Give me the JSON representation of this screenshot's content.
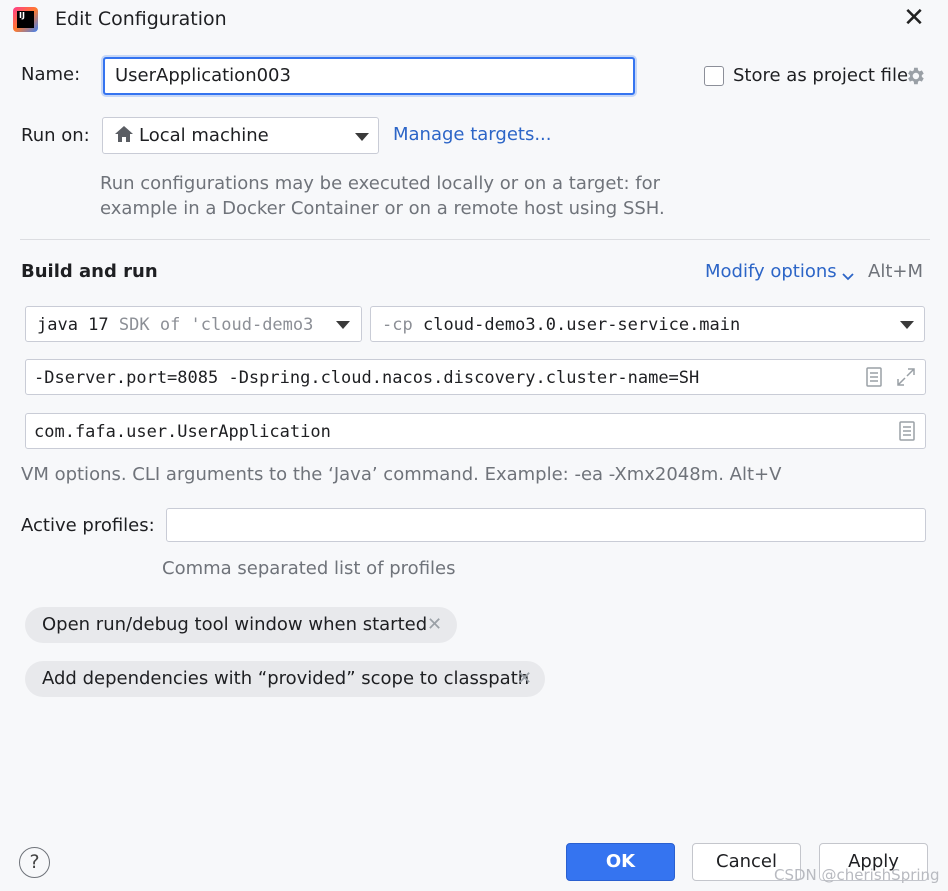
{
  "window": {
    "title": "Edit Configuration",
    "icon_text": "IJ"
  },
  "name_row": {
    "label": "Name:",
    "value": "UserApplication003",
    "store_label": "Store as project file",
    "store_checked": false
  },
  "run_on": {
    "label": "Run on:",
    "value": "Local machine",
    "manage_link": "Manage targets...",
    "hint_line1": "Run configurations may be executed locally or on a target: for",
    "hint_line2": "example in a Docker Container or on a remote host using SSH."
  },
  "build": {
    "heading": "Build and run",
    "modify_link": "Modify options",
    "modify_shortcut": "Alt+M",
    "jdk_version": "java 17",
    "jdk_suffix": "SDK of 'cloud-demo3",
    "cp_prefix": "-cp",
    "cp_value": "cloud-demo3.0.user-service.main",
    "vm_options": "-Dserver.port=8085 -Dspring.cloud.nacos.discovery.cluster-name=SH",
    "main_class": "com.fafa.user.UserApplication",
    "vm_hint": "VM options. CLI arguments to the ‘Java’ command. Example: -ea -Xmx2048m. Alt+V"
  },
  "profiles": {
    "label": "Active profiles:",
    "value": "",
    "hint": "Comma separated list of profiles"
  },
  "chips": [
    {
      "label": "Open run/debug tool window when started"
    },
    {
      "label": "Add dependencies with “provided” scope to classpath"
    }
  ],
  "footer": {
    "help": "?",
    "ok": "OK",
    "cancel": "Cancel",
    "apply": "Apply",
    "watermark": "CSDN @cherishSpring"
  },
  "colors": {
    "accent": "#3574f0",
    "link": "#2c65c7",
    "background": "#f7f8fa"
  }
}
